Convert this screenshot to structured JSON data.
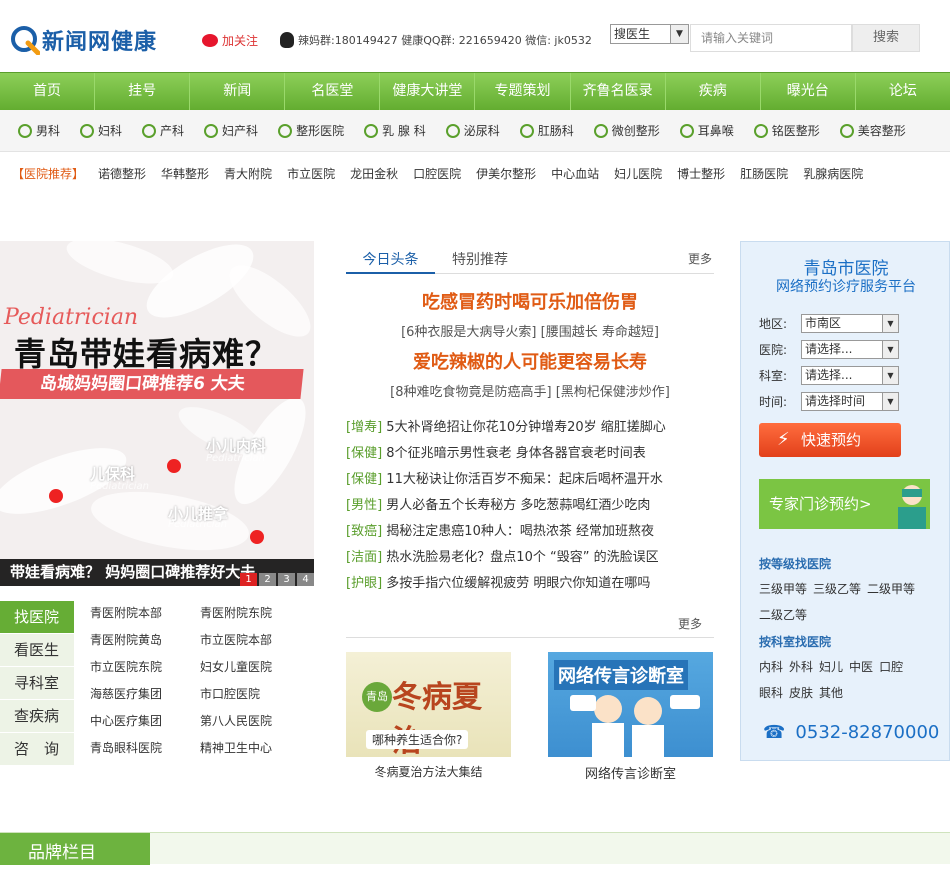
{
  "header": {
    "logo_text": "新闻网健康",
    "follow_label": "加关注",
    "qq_info": "辣妈群:180149427 健康QQ群: 221659420 微信: jk0532",
    "search_type": "搜医生",
    "search_placeholder": "请输入关键词",
    "search_button": "搜索"
  },
  "nav": {
    "items": [
      "首页",
      "挂号",
      "新闻",
      "名医堂",
      "健康大讲堂",
      "专题策划",
      "齐鲁名医录",
      "疾病",
      "曝光台",
      "论坛"
    ]
  },
  "depts": {
    "items": [
      "男科",
      "妇科",
      "产科",
      "妇产科",
      "整形医院",
      "乳 腺 科",
      "泌尿科",
      "肛肠科",
      "微创整形",
      "耳鼻喉",
      "铭医整形",
      "美容整形"
    ]
  },
  "recommend": {
    "label": "【医院推荐】",
    "items": [
      "诺德整形",
      "华韩整形",
      "青大附院",
      "市立医院",
      "龙田金秋",
      "口腔医院",
      "伊美尔整形",
      "中心血站",
      "妇儿医院",
      "博士整形",
      "肛肠医院",
      "乳腺病医院"
    ]
  },
  "banner": {
    "script": "Pediatrician",
    "headline": "青岛带娃看病难？",
    "ribbon": "岛城妈妈圈口碑推荐6 大夫",
    "pin1": "儿保科",
    "pin2": "小儿内科",
    "pin3": "小儿推拿",
    "pin_sub": "Pediatrician",
    "caption": "带娃看病难？ 妈妈圈口碑推荐好大夫",
    "dots": [
      "1",
      "2",
      "3",
      "4"
    ]
  },
  "left_tabs": {
    "items": [
      "找医院",
      "看医生",
      "寻科室",
      "查疾病",
      "咨　询"
    ]
  },
  "hospitals": {
    "items": [
      "青医附院本部",
      "青医附院东院",
      "青医附院黄岛",
      "市立医院本部",
      "市立医院东院",
      "妇女儿童医院",
      "海慈医疗集团",
      "市口腔医院",
      "中心医疗集团",
      "第八人民医院",
      "青岛眼科医院",
      "精神卫生中心"
    ]
  },
  "news": {
    "tab_active": "今日头条",
    "tab_other": "特别推荐",
    "more": "更多",
    "headline1": "吃感冒药时喝可乐加倍伤胃",
    "sub1": "[6种衣服是大病导火索] [腰围越长 寿命越短]",
    "headline2": "爱吃辣椒的人可能更容易长寿",
    "sub2": "[8种难吃食物竟是防癌高手] [黑枸杞保健涉炒作]",
    "items": [
      {
        "tag": "[增寿]",
        "text": "5大补肾绝招让你花10分钟增寿20岁 缩肛搓脚心"
      },
      {
        "tag": "[保健]",
        "text": "8个征兆暗示男性衰老 身体各器官衰老时间表"
      },
      {
        "tag": "[保健]",
        "text": "11大秘诀让你活百岁不痴呆：起床后喝杯温开水"
      },
      {
        "tag": "[男性]",
        "text": "男人必备五个长寿秘方 多吃葱蒜喝红酒少吃肉"
      },
      {
        "tag": "[致癌]",
        "text": "揭秘注定患癌10种人：喝热浓茶 经常加班熬夜"
      },
      {
        "tag": "[洁面]",
        "text": "热水洗脸易老化？盘点10个 “毁容” 的洗脸误区"
      },
      {
        "tag": "[护眼]",
        "text": "多按手指穴位缓解视疲劳 明眼穴你知道在哪吗"
      }
    ],
    "more2": "更多",
    "thumb1_title": "冬病夏治",
    "thumb1_sub": "哪种养生适合你?",
    "thumb1_badge": "青岛",
    "thumb1_caption": "冬病夏治方法大集结",
    "thumb2_title": "网络传言诊断室",
    "thumb2_caption": "网络传言诊断室"
  },
  "panel": {
    "title1": "青岛市医院",
    "title2": "网络预约诊疗服务平台",
    "rows": [
      {
        "label": "地区:",
        "value": "市南区"
      },
      {
        "label": "医院:",
        "value": "请选择..."
      },
      {
        "label": "科室:",
        "value": "请选择..."
      },
      {
        "label": "时间:",
        "value": "请选择时间"
      }
    ],
    "quick_button": "快速预约",
    "expert_button": "专家门诊预约>",
    "level_heading": "按等级找医院",
    "levels": [
      "三级甲等",
      "三级乙等",
      "二级甲等",
      "二级乙等"
    ],
    "dept_heading": "按科室找医院",
    "dept_links": [
      "内科",
      "外科",
      "妇儿",
      "中医",
      "口腔",
      "眼科",
      "皮肤",
      "其他"
    ],
    "phone": "0532-82870000"
  },
  "brand": {
    "label": "品牌栏目"
  }
}
